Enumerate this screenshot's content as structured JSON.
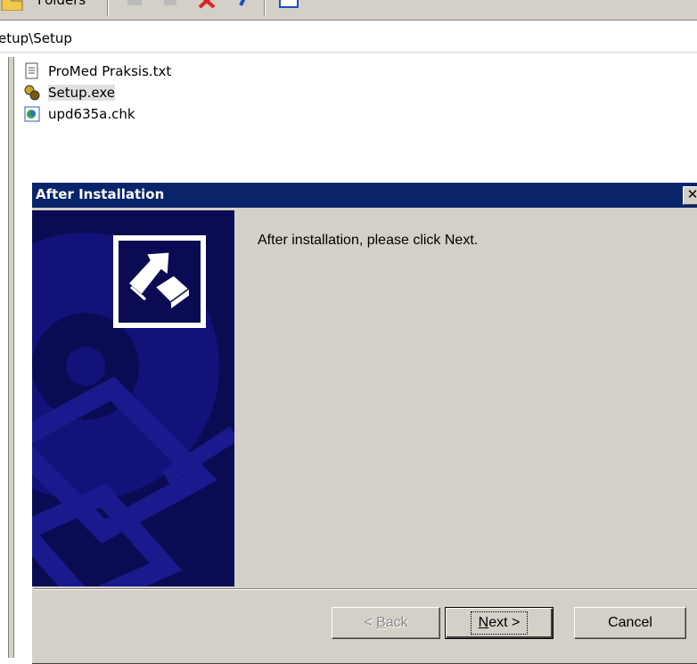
{
  "toolbar": {
    "folders_label": "Folders",
    "icons": [
      "folder-icon",
      "move-to-icon",
      "copy-to-icon",
      "delete-icon",
      "undo-icon",
      "views-icon"
    ]
  },
  "address": {
    "path": "etup\\Setup"
  },
  "files": [
    {
      "name": "ProMed Praksis.txt",
      "icon": "text-file-icon"
    },
    {
      "name": "Setup.exe",
      "icon": "setup-exe-icon",
      "selected": true
    },
    {
      "name": "upd635a.chk",
      "icon": "chk-file-icon"
    }
  ],
  "dialog": {
    "title": "After Installation",
    "close_label": "✕",
    "message": "After installation, please click Next.",
    "back_label_pre": "< ",
    "back_label_accel": "B",
    "back_label_post": "ack",
    "next_label_accel": "N",
    "next_label_post": "ext >",
    "cancel_label": "Cancel",
    "colors": {
      "titlebar": "#0a246a",
      "side_panel": "#0b0b53",
      "face": "#d4d0c8"
    }
  }
}
